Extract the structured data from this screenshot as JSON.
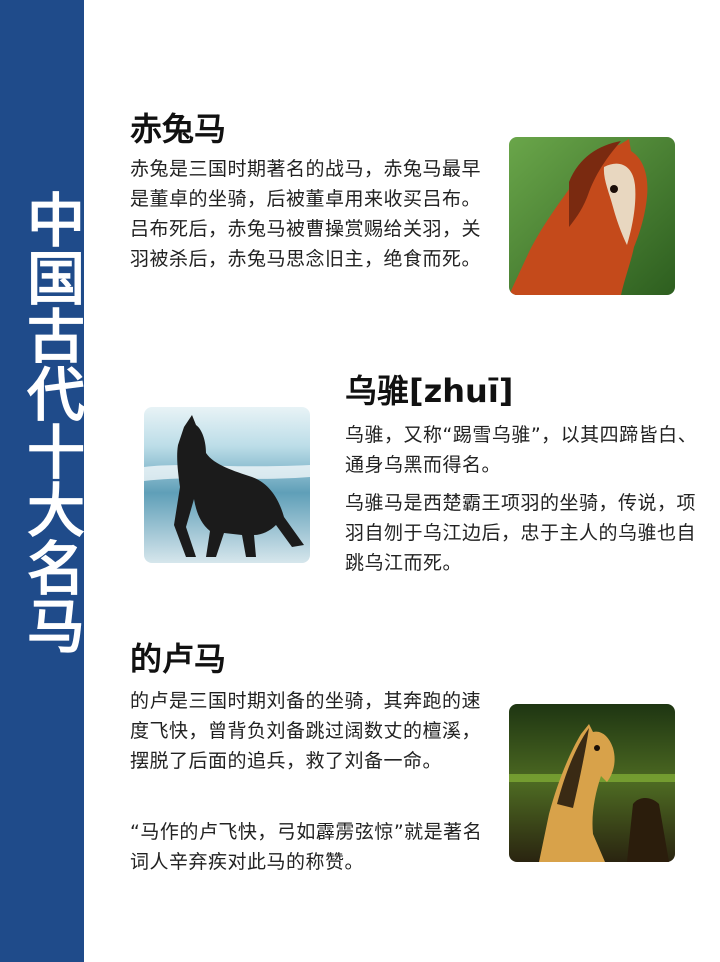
{
  "sidebar": {
    "title": "中国古代十大名马"
  },
  "sections": [
    {
      "title": "赤兔马",
      "paragraphs": [
        "赤兔是三国时期著名的战马，赤兔马最早是董卓的坐骑，后被董卓用来收买吕布。吕布死后，赤兔马被曹操赏赐给关羽，关羽被杀后，赤兔马思念旧主，绝食而死。"
      ],
      "image_icon": "chestnut-horse-icon",
      "colors": {
        "background": "#3f7a2e",
        "horse": "#c9481c"
      }
    },
    {
      "title": "乌骓[zhuī]",
      "paragraphs": [
        "乌骓，又称“踢雪乌骓”，以其四蹄皆白、通身乌黑而得名。",
        "乌骓马是西楚霸王项羽的坐骑，传说，项羽自刎于乌江边后，忠于主人的乌骓也自跳乌江而死。"
      ],
      "image_icon": "black-horse-icon",
      "colors": {
        "background": "#bcdde8",
        "horse": "#1b1b1b"
      }
    },
    {
      "title": "的卢马",
      "paragraphs": [
        "的卢是三国时期刘备的坐骑，其奔跑的速度飞快，曾背负刘备跳过阔数丈的檀溪，摆脱了后面的追兵，救了刘备一命。",
        "“马作的卢飞快，弓如霹雳弦惊”就是著名词人辛弃疾对此马的称赞。"
      ],
      "image_icon": "golden-horse-icon",
      "colors": {
        "background": "#2f4a1c",
        "horse": "#d8a24a"
      }
    }
  ]
}
